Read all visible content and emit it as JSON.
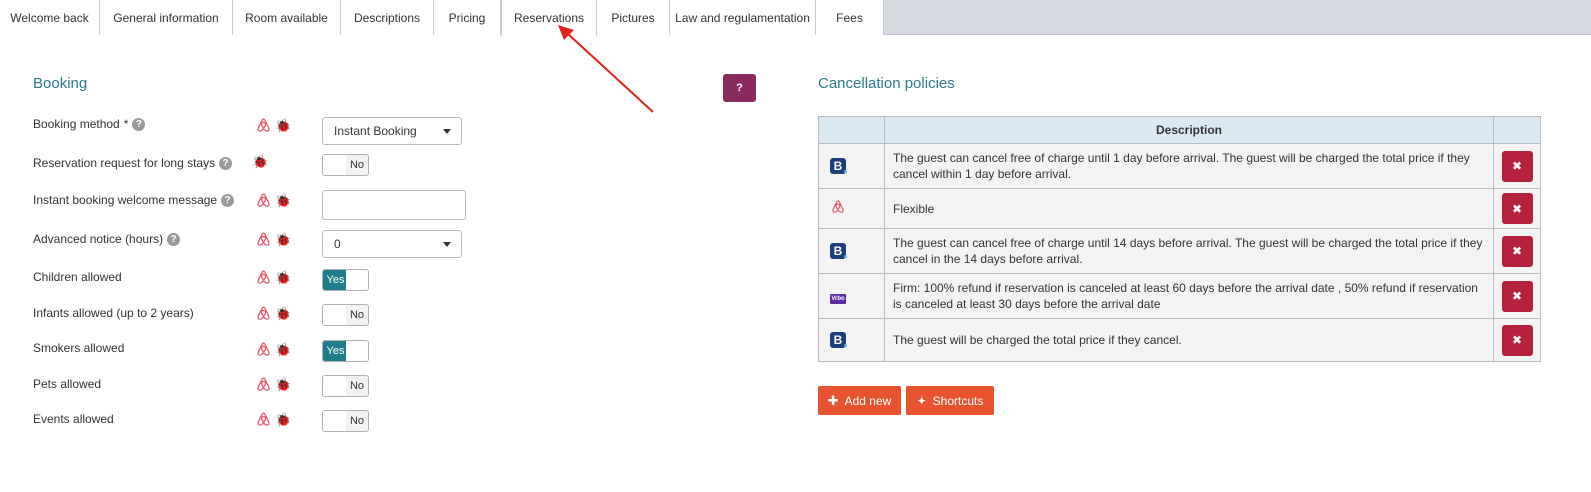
{
  "tabs": [
    "Welcome back",
    "General information",
    "Room available",
    "Descriptions",
    "Pricing",
    "Reservations",
    "Pictures",
    "Law and regulamentation",
    "Fees"
  ],
  "active_tab": "Reservations",
  "booking": {
    "title": "Booking",
    "fields": {
      "booking_method": {
        "label": "Booking method",
        "required_mark": "*",
        "value": "Instant Booking"
      },
      "long_stays": {
        "label": "Reservation request for long stays",
        "value": "No"
      },
      "welcome_message": {
        "label": "Instant booking welcome message",
        "value": ""
      },
      "advanced_notice": {
        "label": "Advanced notice (hours)",
        "value": "0"
      },
      "children": {
        "label": "Children allowed",
        "value": "Yes"
      },
      "infants": {
        "label": "Infants allowed (up to 2 years)",
        "value": "No"
      },
      "smokers": {
        "label": "Smokers allowed",
        "value": "Yes"
      },
      "pets": {
        "label": "Pets allowed",
        "value": "No"
      },
      "events": {
        "label": "Events allowed",
        "value": "No"
      }
    }
  },
  "help_button": "?",
  "cancellation": {
    "title": "Cancellation policies",
    "header_description": "Description",
    "rows": [
      {
        "channel_icon": "booking-com-icon",
        "text": "The guest can cancel free of charge until 1 day before arrival. The guest will be charged the total price if they cancel within 1 day before arrival."
      },
      {
        "channel_icon": "airbnb-icon",
        "text": "Flexible"
      },
      {
        "channel_icon": "booking-com-icon",
        "text": "The guest can cancel free of charge until 14 days before arrival. The guest will be charged the total price if they cancel in the 14 days before arrival."
      },
      {
        "channel_icon": "vrbo-icon",
        "text": "Firm: 100% refund if reservation is canceled at least 60 days before the arrival date , 50% refund if reservation is canceled at least 30 days before the arrival date"
      },
      {
        "channel_icon": "booking-com-icon",
        "text": "The guest will be charged the total price if they cancel."
      }
    ],
    "add_new_label": "Add new",
    "shortcuts_label": "Shortcuts"
  },
  "colors": {
    "accent_teal": "#2b7a8c",
    "toggle_on": "#1e7d8c",
    "delete_red": "#b6213e",
    "orange": "#e8532f",
    "help_purple": "#8b2a5f",
    "arrow_red": "#e0241b"
  }
}
